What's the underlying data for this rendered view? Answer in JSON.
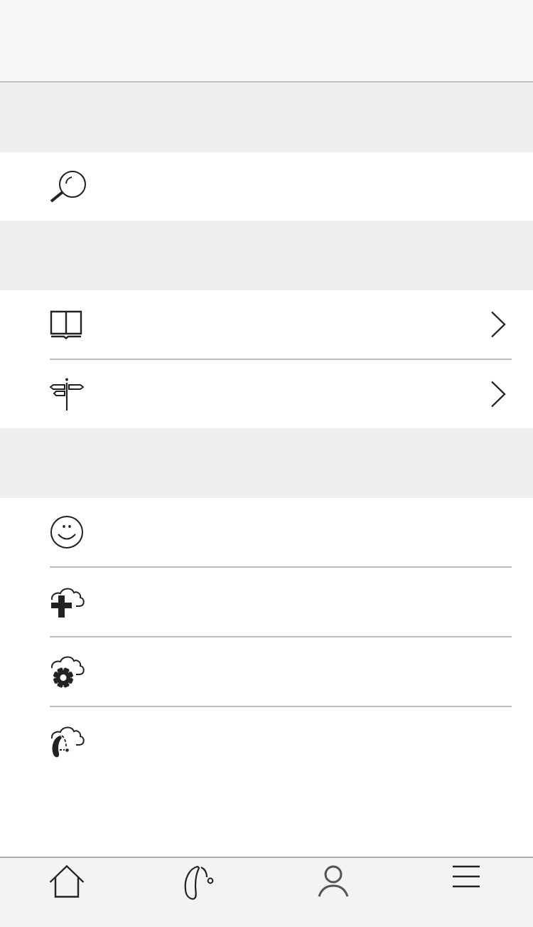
{
  "sections": [
    {
      "rows": [
        {
          "chevron": false
        }
      ]
    },
    {
      "rows": [
        {
          "chevron": true
        },
        {
          "chevron": true
        }
      ]
    },
    {
      "rows": [
        {
          "chevron": false
        },
        {
          "chevron": false
        },
        {
          "chevron": false
        },
        {
          "chevron": false
        }
      ]
    }
  ],
  "tab_bar": {
    "tabs": [
      {
        "selected": false
      },
      {
        "selected": false
      },
      {
        "selected": false
      },
      {
        "selected": false
      }
    ]
  }
}
